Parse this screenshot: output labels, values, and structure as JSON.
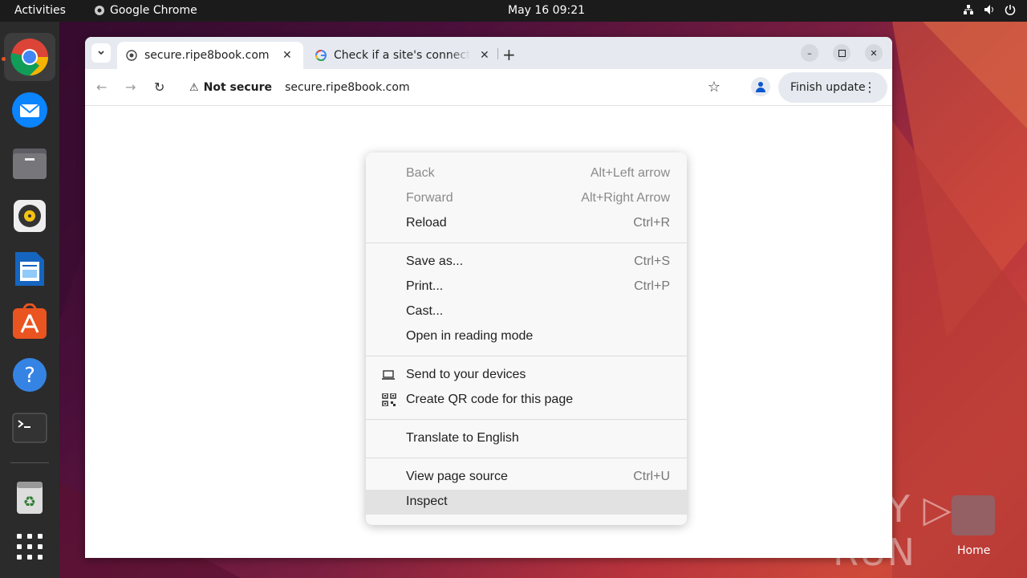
{
  "topbar": {
    "activities": "Activities",
    "app_name": "Google Chrome",
    "clock": "May 16  09:21"
  },
  "dock": {
    "items": [
      "chrome-icon",
      "thunderbird-icon",
      "files-icon",
      "rhythmbox-icon",
      "writer-icon",
      "app-center-icon",
      "help-icon",
      "terminal-icon",
      "trash-icon",
      "show-apps-icon"
    ]
  },
  "browser": {
    "tabs": [
      {
        "title": "secure.ripe8book.com",
        "active": true
      },
      {
        "title": "Check if a site's connection is secure",
        "active": false
      }
    ],
    "omnibox": {
      "security_label": "Not secure",
      "url": "secure.ripe8book.com"
    },
    "finish_update": "Finish update"
  },
  "context_menu": {
    "items": [
      {
        "label": "Back",
        "shortcut": "Alt+Left arrow",
        "enabled": false
      },
      {
        "label": "Forward",
        "shortcut": "Alt+Right Arrow",
        "enabled": false
      },
      {
        "label": "Reload",
        "shortcut": "Ctrl+R",
        "enabled": true
      },
      {
        "label": "Save as...",
        "shortcut": "Ctrl+S",
        "enabled": true
      },
      {
        "label": "Print...",
        "shortcut": "Ctrl+P",
        "enabled": true
      },
      {
        "label": "Cast...",
        "shortcut": "",
        "enabled": true
      },
      {
        "label": "Open in reading mode",
        "shortcut": "",
        "enabled": true
      },
      {
        "label": "Send to your devices",
        "shortcut": "",
        "enabled": true
      },
      {
        "label": "Create QR code for this page",
        "shortcut": "",
        "enabled": true
      },
      {
        "label": "Translate to English",
        "shortcut": "",
        "enabled": true
      },
      {
        "label": "View page source",
        "shortcut": "Ctrl+U",
        "enabled": true
      },
      {
        "label": "Inspect",
        "shortcut": "",
        "enabled": true,
        "highlighted": true
      }
    ]
  },
  "watermark": "ANY RUN",
  "desktop": {
    "home_label": "Home"
  },
  "colors": {
    "accent": "#e95420",
    "topbar": "#1b1b1b",
    "dock": "#2b2b2b",
    "tabstrip": "#e6eaf0"
  }
}
